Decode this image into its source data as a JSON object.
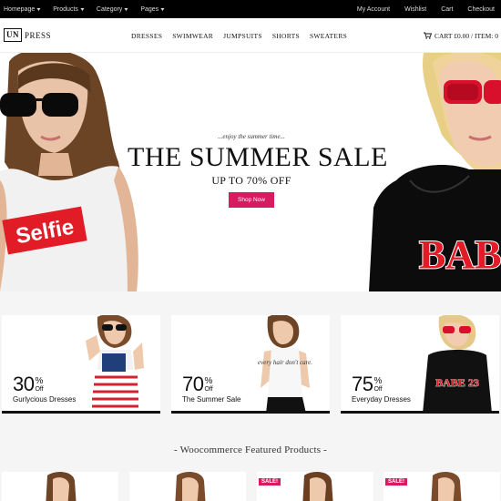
{
  "topbar": {
    "left": [
      "Homepage",
      "Products",
      "Category",
      "Pages"
    ],
    "right": [
      "My Account",
      "Wishlist",
      "Cart",
      "Checkout"
    ]
  },
  "header": {
    "logo_box": "UN",
    "logo_text": "PRESS",
    "nav": [
      "DRESSES",
      "SWIMWEAR",
      "JUMPSUITS",
      "SHORTS",
      "SWEATERS"
    ],
    "cart_text": "CART £0.00 / ITEM: 0"
  },
  "hero": {
    "tagline": "...enjoy the summer time...",
    "title": "THE SUMMER SALE",
    "subtitle": "UP TO 70% OFF",
    "button": "Shop Now",
    "left_shirt_text": "Selfie",
    "right_shirt_text": "BAB"
  },
  "promos": [
    {
      "number": "30",
      "percent": "%",
      "off": "Off",
      "caption": "Gurlycious Dresses"
    },
    {
      "number": "70",
      "percent": "%",
      "off": "Off",
      "caption": "The Summer Sale"
    },
    {
      "number": "75",
      "percent": "%",
      "off": "Off",
      "caption": "Everyday Dresses"
    }
  ],
  "promo_shirt_texts": [
    "every hair don't care.",
    "BABE 23"
  ],
  "featured": {
    "title": "-   Woocommerce Featured Products   -",
    "sale_label": "SALE!"
  },
  "colors": {
    "accent": "#d81b60",
    "topbar": "#000000",
    "section_bg": "#f5f5f5"
  }
}
